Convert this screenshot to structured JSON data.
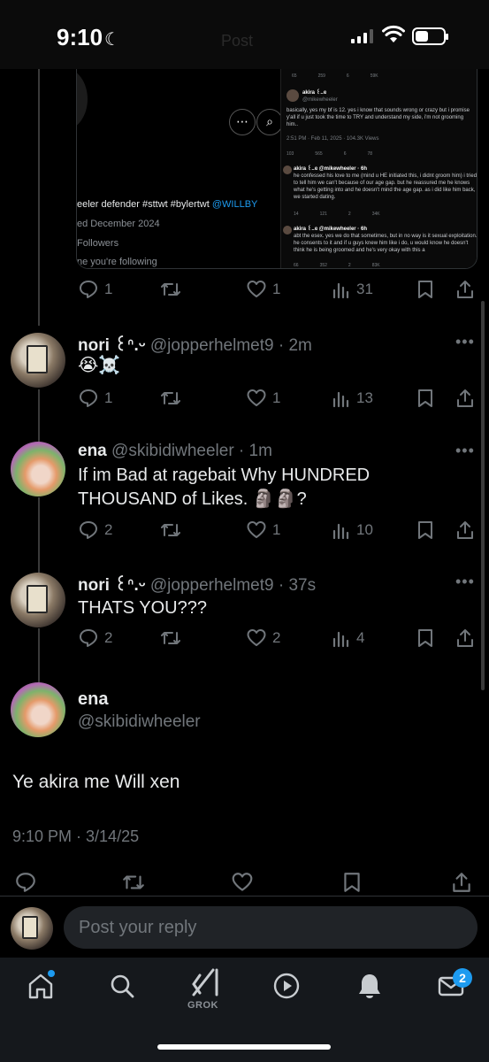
{
  "status_bar": {
    "time": "9:10",
    "moon_glyph": "☾",
    "faded_title": "Post"
  },
  "quoted_media": {
    "left_text": [
      "eeler defender #sttwt #bylertwt",
      "@WILLBY",
      "ed December 2024",
      "Followers",
      "ne you're following"
    ],
    "more_glyph": "⋯",
    "search_glyph": "⌕",
    "right_header_name": "akira ꒰..ɞ",
    "right_header_handle": "@mikewheeler",
    "right_top_stats": [
      "65",
      "259",
      "6",
      "59K"
    ],
    "right_main_text": "basically, yes my bf is 12. yes i know that sounds wrong or crazy but i promise y'all if u just took the time to TRY and understand my side, i'm not grooming him..",
    "right_main_meta": "2:51 PM · Feb 11, 2025 · 104.3K Views",
    "right_main_stats": [
      "103",
      "565",
      "6",
      "78"
    ],
    "reply1_head": "akira ꒰..ɞ @mikewheeler · 6h",
    "reply1_text": "he confessed his love to me (mind u HE initiated this, i didnt groom him) i tried to tell him we can't because of our age gap. but he reassured me he knows what he's getting into and he doesn't mind the age gap. as i did like him back, we started dating.",
    "reply1_stats": [
      "14",
      "121",
      "2",
      "34K"
    ],
    "reply2_head": "akira ꒰..ɞ @mikewheeler · 6h",
    "reply2_text": "abt the esex. yes we do that sometimes, but in no way is it sexual exploitation. he consents to it and if u guys knew him like i do, u would know he doesn't think he is being groomed and he's very okay with this a",
    "reply2_stats": [
      "66",
      "352",
      "2",
      "83K"
    ]
  },
  "first_actions": {
    "replies": "1",
    "reposts": "",
    "likes": "1",
    "views": "31"
  },
  "tweets": [
    {
      "name": "nori ꒰ᐢ.ᵕ",
      "handle": "@jopperhelmet9 · 2m",
      "text": "😭☠️",
      "replies": "1",
      "likes": "1",
      "views": "13"
    },
    {
      "name": "ena",
      "handle": "@skibidiwheeler · 1m",
      "text": "If im Bad at ragebait Why HUNDRED THOUSAND of Likes. 🗿🗿?",
      "replies": "2",
      "likes": "1",
      "views": "10"
    },
    {
      "name": "nori ꒰ᐢ.ᵕ",
      "handle": "@jopperhelmet9 · 37s",
      "text": "THATS YOU???",
      "replies": "2",
      "likes": "2",
      "views": "4"
    }
  ],
  "more_glyph": "•••",
  "main_tweet": {
    "name": "ena",
    "handle": "@skibidiwheeler",
    "text": "Ye akira me Will xen",
    "timestamp": "9:10 PM · 3/14/25"
  },
  "reply_bar": {
    "placeholder": "Post your reply"
  },
  "bottom_nav": {
    "grok_label": "GROK",
    "messages_badge": "2"
  },
  "colors": {
    "accent": "#1d9bf0",
    "background": "#000000",
    "muted": "#71767b",
    "text": "#e7e9ea"
  }
}
